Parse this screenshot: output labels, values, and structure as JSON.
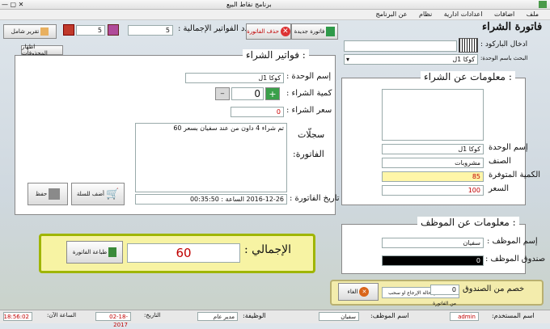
{
  "window": {
    "title": "برنامج نقاط البيع"
  },
  "menu": [
    "ملف",
    "اضافات",
    "اعدادات ادارية",
    "نظام",
    "عن البرنامج"
  ],
  "toolbar": {
    "report_btn": "تقرير شامل",
    "counter_a": "5",
    "invoices_count_label": "عدد الفواتير الإجمالية :",
    "invoices_count": "5",
    "delete_invoice_btn": "حذف الفاتورة",
    "new_invoice_btn": "فاتورة جديدة",
    "show_items_btn": "اظهار المحذوفات"
  },
  "purchase_invoice": {
    "heading": "فاتورة الشراء",
    "barcode_label": "ادخال الباركود :",
    "search_label": "البحث باسم الوحدة:",
    "search_value": "كوكا 1ل"
  },
  "purchase_info": {
    "legend": "معلومات عن الشراء :",
    "unit_name_label": "إسم الوحدة",
    "unit_name": "كوكا 1ل",
    "category_label": "الصنف",
    "category": "مشروبات",
    "qty_available_label": "الكمية المتوفرة",
    "qty_available": "85",
    "price_label": "السعر",
    "price": "100"
  },
  "invoices_section": {
    "legend": "فواتير الشراء :",
    "unit_name_label": "إسم الوحدة :",
    "unit_name": "كوكا 1ل",
    "qty_label": "كمية الشراء :",
    "qty": "0",
    "price_label": "سعر الشراء :",
    "price": "0",
    "record_label": "سجلّات",
    "invoice_word": "الفاتورة:",
    "record_text": "تم شراء 4 داون من عند سفيان بسعر 60",
    "add_to_cart_btn": "أضف للسلة",
    "save_btn": "حفظ",
    "date_label": "تاريخ الفاتورة :",
    "date_value": "2016-12-26  الساعة :  00:35:50"
  },
  "employee_info": {
    "legend": "معلومات عن الموظف :",
    "name_label": "إسم الموظف :",
    "name": "سفيان",
    "box_label": "صندوق الموظف :",
    "box_value": "0"
  },
  "total": {
    "label": "الإجمالي :",
    "value": "60",
    "print_btn": "طباعة الفاتورة"
  },
  "withdraw": {
    "label": "خصم من الصندوق",
    "value": "0",
    "cancel_btn": "الغاء",
    "note": "استعمل في حالة الإرجاع او سحب من الفاتورة"
  },
  "statusbar": {
    "user_label": "اسم المستخدم:",
    "user": "admin",
    "employee_label": "اسم الموظف:",
    "employee": "سفيان",
    "job_label": "الوظيفة:",
    "job": "مدير عام",
    "date_label": "التاريخ:",
    "date": "02-18-2017",
    "time_label": "الساعة الآن:",
    "time": "18:56:02"
  },
  "colors": {
    "accent_red": "#cc0000",
    "qty_yellow": "#fff6a8",
    "total_bg": "#f7f3a3",
    "total_border": "#9fb500"
  }
}
